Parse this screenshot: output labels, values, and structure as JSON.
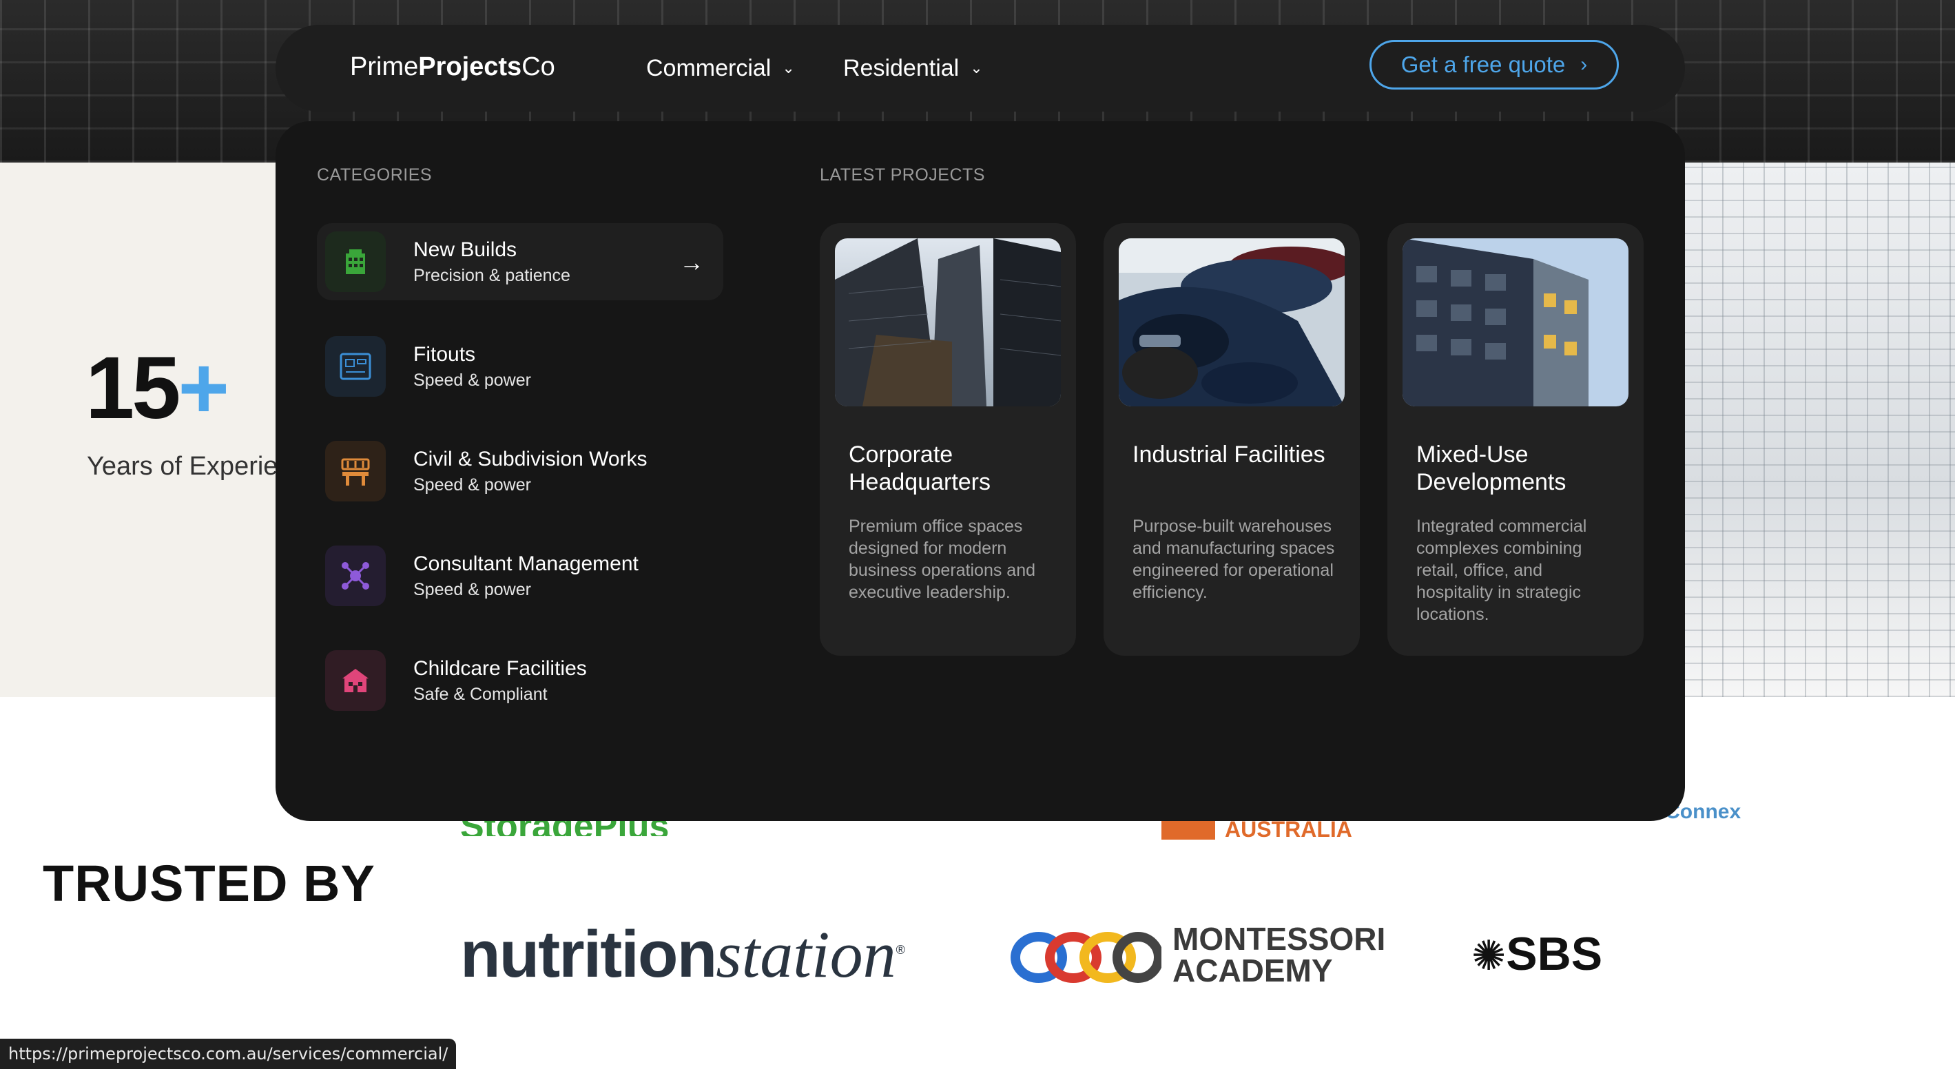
{
  "navbar": {
    "logo": {
      "prime": "Prime",
      "projects": "Projects",
      "co": "Co"
    },
    "items": [
      {
        "label": "Commercial"
      },
      {
        "label": "Residential"
      }
    ],
    "quote_label": "Get a free quote"
  },
  "mega": {
    "categories_title": "CATEGORIES",
    "latest_title": "LATEST PROJECTS",
    "categories": [
      {
        "title": "New Builds",
        "subtitle": "Precision & patience",
        "icon": "building-icon",
        "color": "#3aa63a"
      },
      {
        "title": "Fitouts",
        "subtitle": "Speed & power",
        "icon": "blueprint-icon",
        "color": "#3b8fd6"
      },
      {
        "title": "Civil & Subdivision Works",
        "subtitle": "Speed & power",
        "icon": "construction-barrier-icon",
        "color": "#e08b3a"
      },
      {
        "title": "Consultant Management",
        "subtitle": "Speed & power",
        "icon": "network-icon",
        "color": "#8e5ad9"
      },
      {
        "title": "Childcare Facilities",
        "subtitle": "Safe & Compliant",
        "icon": "house-icon",
        "color": "#e0457a"
      }
    ],
    "projects": [
      {
        "title": "Corporate Headquarters",
        "description": "Premium office spaces designed for modern business operations and executive leadership.",
        "image": "skyscrapers-photo"
      },
      {
        "title": "Industrial Facilities",
        "description": "Purpose-built warehouses and manufacturing spaces engineered for operational efficiency.",
        "image": "parked-cars-photo"
      },
      {
        "title": "Mixed-Use Developments",
        "description": "Integrated commercial complexes combining retail, office, and hospitality in strategic locations.",
        "image": "apartment-building-photo"
      }
    ]
  },
  "stats": {
    "number": "15",
    "plus": "+",
    "caption": "Years of Experience"
  },
  "trusted": {
    "heading": "TRUSTED BY",
    "partial_logos": [
      "StoragePlus",
      "AUSTRALIA",
      "WestConnex"
    ],
    "nutrition": {
      "bold": "nutrition",
      "italic": "station"
    },
    "montessori": {
      "line1": "MONTESSORI",
      "line2": "ACADEMY"
    },
    "sbs": "SBS"
  },
  "statusbar": {
    "url": "https://primeprojectsco.com.au/services/commercial/"
  },
  "colors": {
    "accent": "#4ea6ea",
    "panel": "#161616",
    "nav": "#1e1e1e"
  }
}
